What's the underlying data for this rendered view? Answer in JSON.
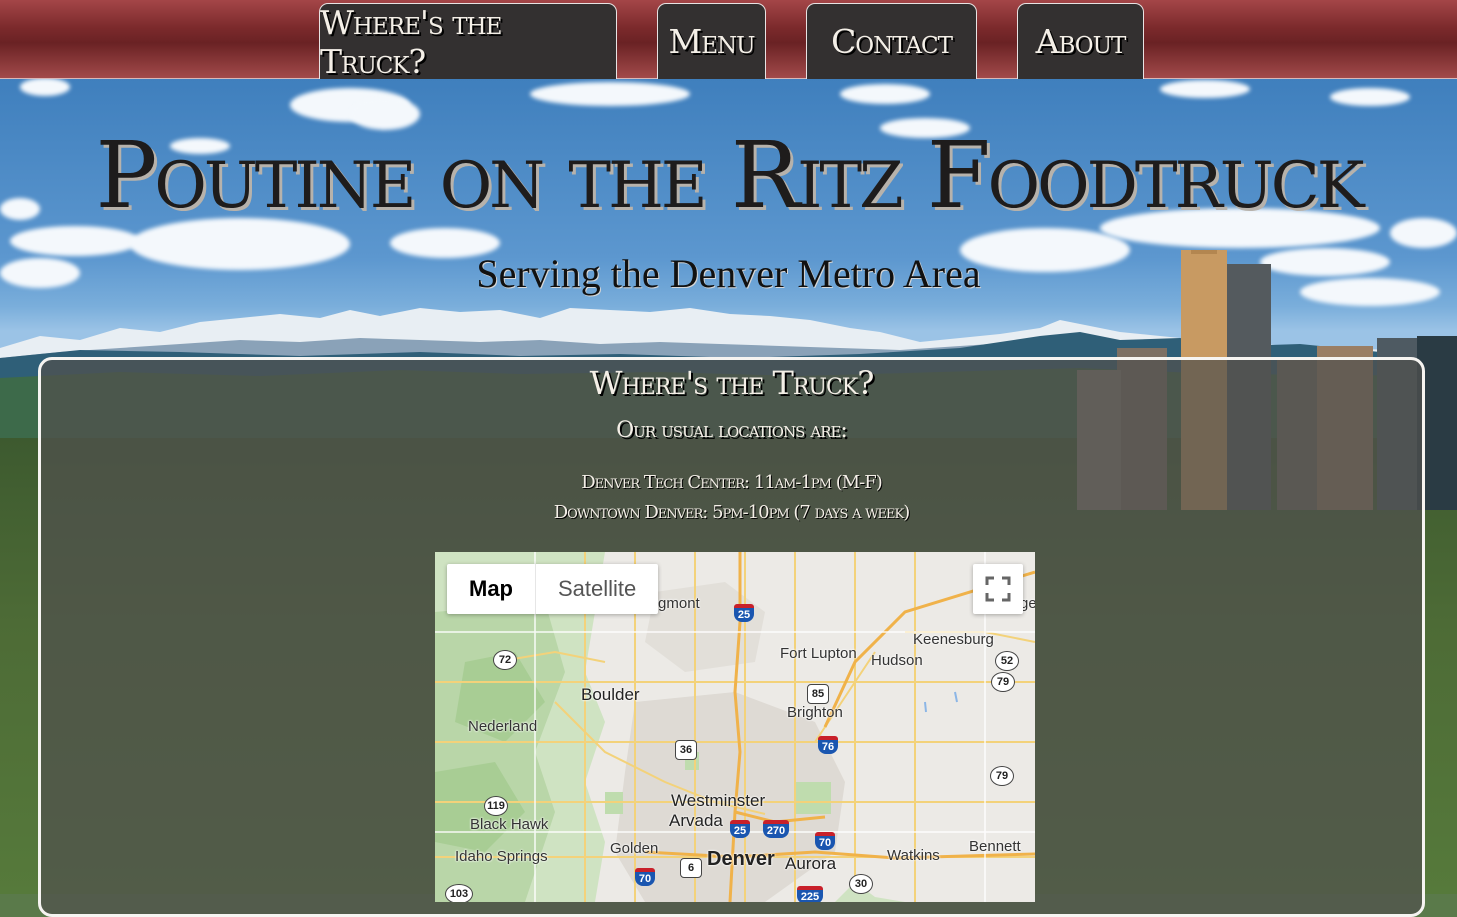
{
  "nav": {
    "tabs": [
      {
        "label": "Where's the Truck?"
      },
      {
        "label": "Menu"
      },
      {
        "label": "Contact"
      },
      {
        "label": "About"
      }
    ]
  },
  "header": {
    "title": "Poutine on the Ritz Foodtruck",
    "subtitle": "Serving the Denver Metro Area"
  },
  "content": {
    "heading": "Where's the Truck?",
    "subheading": "Our usual locations are:",
    "locations": [
      "Denver Tech Center: 11am-1pm (M-F)",
      "Downtown Denver: 5pm-10pm (7 days a week)"
    ]
  },
  "map": {
    "type_buttons": {
      "map": "Map",
      "satellite": "Satellite"
    },
    "fullscreen_icon": "fullscreen-icon",
    "places": {
      "longmont": "Longmont",
      "fort_lupton": "Fort Lupton",
      "keenesburg": "Keenesburg",
      "hudson": "Hudson",
      "boulder": "Boulder",
      "brighton": "Brighton",
      "nederland": "Nederland",
      "westminster": "Westminster",
      "arvada": "Arvada",
      "black_hawk": "Black Hawk",
      "golden": "Golden",
      "idaho_springs": "Idaho Springs",
      "denver": "Denver",
      "aurora": "Aurora",
      "watkins": "Watkins",
      "bennett": "Bennett",
      "edge": "ge"
    },
    "shields": {
      "i25_north": "25",
      "i25_south": "25",
      "i76": "76",
      "i270": "270",
      "i70_east": "70",
      "i70_west": "70",
      "i225": "225",
      "us85": "85",
      "us36": "36",
      "us6": "6",
      "co72": "72",
      "co52": "52",
      "co79_north": "79",
      "co79_south": "79",
      "co119": "119",
      "co103": "103",
      "co30": "30"
    }
  },
  "colors": {
    "nav_bar": "#7c2a2c",
    "nav_tab": "#333030",
    "panel": "#50504e",
    "text_light": "#f4efe7"
  }
}
